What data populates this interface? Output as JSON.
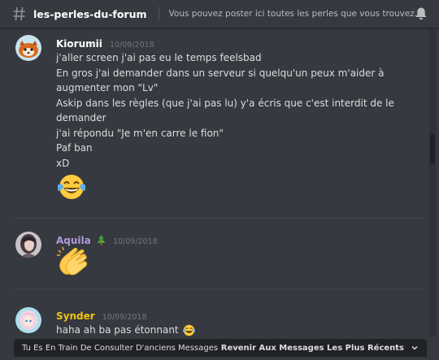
{
  "channel": {
    "name": "les-perles-du-forum",
    "topic": "Vous pouvez poster ici toutes les perles que vous trouvez sur ..."
  },
  "colors": {
    "background": "#36393f",
    "header_text": "#ffffff",
    "kiorumii": "#ffffff",
    "aquila": "#b19cd9",
    "synder": "#f1c40f",
    "timestamp": "#72767d"
  },
  "messages": [
    {
      "author": "Kiorumii",
      "timestamp": "10/09/2018",
      "lines": [
        "j'aller screen j'ai pas eu le temps feelsbad",
        "En gros j'ai demander dans un serveur si quelqu'un peux m'aider à",
        "augmenter mon \"Lv\"",
        "Askip dans les règles (que j'ai pas lu) y'a écris que c'est interdit de le",
        "demander",
        "j'ai répondu \"Je m'en carre le fion\"",
        "Paf ban",
        "xD"
      ],
      "emoji": "joy-emoji"
    },
    {
      "author": "Aquila",
      "author_badge": "christmas-tree-emoji",
      "timestamp": "10/09/2018",
      "emoji": "clapping-hands-emoji"
    },
    {
      "author": "Synder",
      "timestamp": "10/09/2018",
      "text": "haha ah ba pas étonnant",
      "emoji": "joy-emoji"
    }
  ],
  "bottom_bar": {
    "older_label": "Tu Es En Train De Consulter D'anciens Messages",
    "jump_label": "Revenir Aux Messages Les Plus Récents"
  }
}
